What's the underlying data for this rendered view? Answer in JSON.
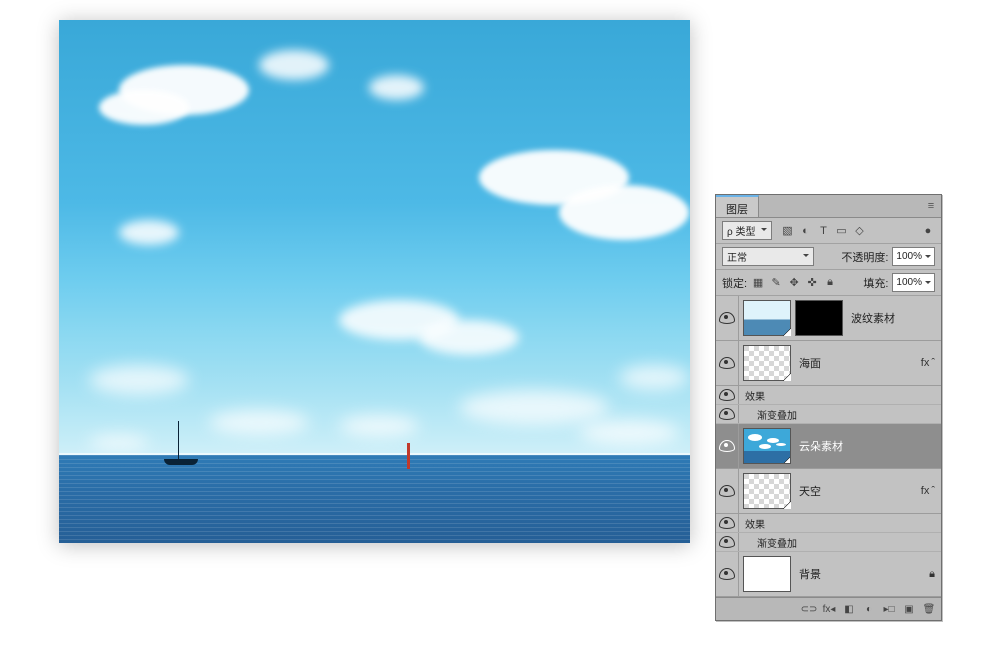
{
  "panel": {
    "title": "图层",
    "filter_label": "ρ 类型",
    "blend_mode": "正常",
    "opacity_label": "不透明度:",
    "opacity_value": "100%",
    "lock_label": "锁定:",
    "fill_label": "填充:",
    "fill_value": "100%",
    "fx_label": "效果",
    "fx_gradient": "渐变叠加",
    "fx_suffix": "fx"
  },
  "layers": [
    {
      "name": "波纹素材",
      "thumb": "sea",
      "mask": true,
      "selected": false,
      "fx": false,
      "locked": false
    },
    {
      "name": "海面",
      "thumb": "trans",
      "mask": false,
      "selected": false,
      "fx": true,
      "locked": false
    },
    {
      "name": "云朵素材",
      "thumb": "clouds",
      "mask": false,
      "selected": true,
      "fx": false,
      "locked": false
    },
    {
      "name": "天空",
      "thumb": "trans",
      "mask": false,
      "selected": false,
      "fx": true,
      "locked": false
    },
    {
      "name": "背景",
      "thumb": "white",
      "mask": false,
      "selected": false,
      "fx": false,
      "locked": true
    }
  ]
}
